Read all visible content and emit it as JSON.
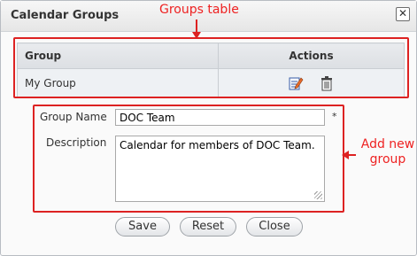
{
  "dialog": {
    "title": "Calendar Groups",
    "close_glyph": "✕"
  },
  "annotations": {
    "groups_table": "Groups table",
    "add_new_group_line1": "Add new",
    "add_new_group_line2": "group",
    "color": "#ee2222"
  },
  "table": {
    "headers": [
      "Group",
      "Actions"
    ],
    "rows": [
      {
        "group": "My Group",
        "actions": [
          "edit-icon",
          "trash-icon"
        ]
      }
    ]
  },
  "form": {
    "group_name_label": "Group Name",
    "group_name_value": "DOC Team",
    "required_marker": "*",
    "description_label": "Description",
    "description_value": "Calendar for members of DOC Team."
  },
  "buttons": {
    "save": "Save",
    "reset": "Reset",
    "close": "Close"
  }
}
